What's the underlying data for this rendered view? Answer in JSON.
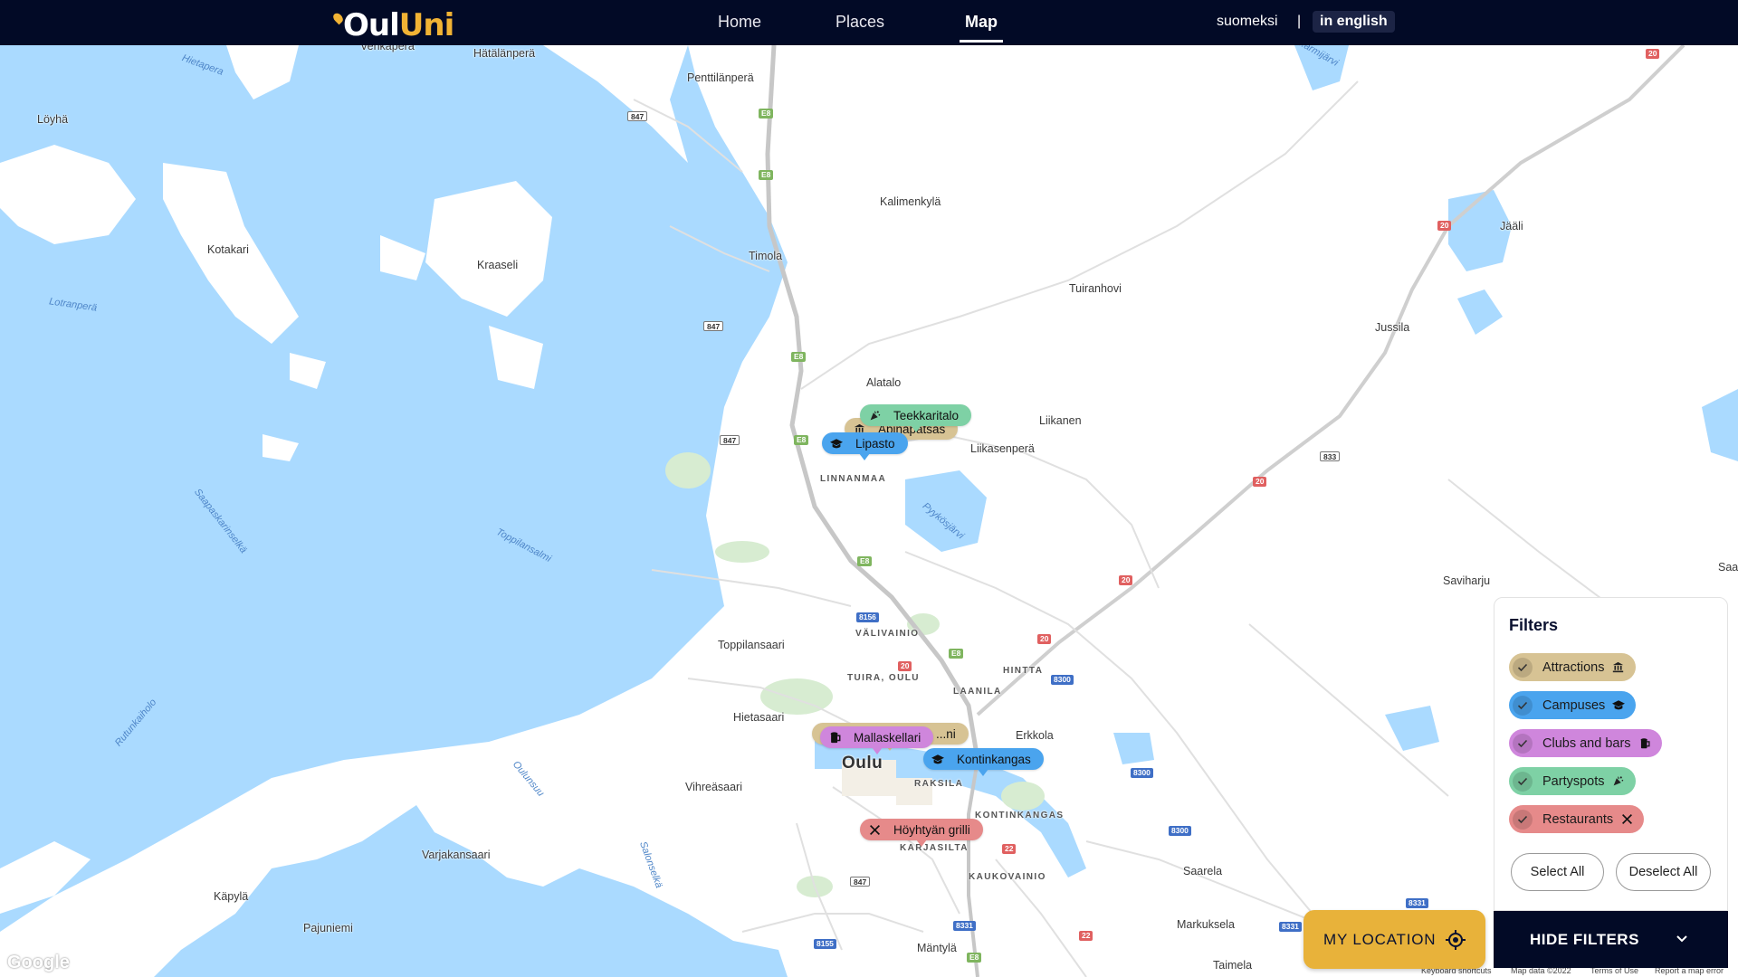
{
  "nav": {
    "logo_oul": "Oul",
    "logo_uni": "Uni",
    "links": [
      "Home",
      "Places",
      "Map"
    ],
    "active": "Map",
    "lang_fi": "suomeksi",
    "lang_sep": "|",
    "lang_en": "in english"
  },
  "map": {
    "places": [
      "Vehkaperä",
      "Hätälänperä",
      "Penttilänperä",
      "Löyhä",
      "Kalimenkylä",
      "Kotakari",
      "Kraaseli",
      "Timola",
      "Tuiranhovi",
      "Jussila",
      "Jääli",
      "Alatalo",
      "Liikanen",
      "Liikasenperä",
      "LINNANMAA",
      "Saviharju",
      "Toppilansaari",
      "VÄLIVAINIO",
      "TUIRA, OULU",
      "HINTTA",
      "LAANILA",
      "Hietasaari",
      "Oulu",
      "Erkkola",
      "Vihreäsaari",
      "RAKSILA",
      "KONTINKANGAS",
      "KARJASILTA",
      "Varjakansaari",
      "KAUKOVAINIO",
      "Saarela",
      "Käpylä",
      "Pajuniemi",
      "Markuksela",
      "Mäntylä",
      "Taimela",
      "Saa"
    ],
    "water_labels": [
      "Hietapera",
      "Lotranperä",
      "Saapaskarinselkä",
      "Toppilansalmi",
      "Pyykösjärvi",
      "Rutunkaiholo",
      "Oulunsuu",
      "Salonselkä",
      "...armijärvi"
    ],
    "shields": [
      "847",
      "E8",
      "20",
      "8156",
      "8300",
      "8155",
      "833",
      "8331",
      "22"
    ],
    "google": "Google",
    "attrib_keyboard": "Keyboard shortcuts",
    "attrib_data": "Map data ©2022",
    "attrib_terms": "Terms of Use",
    "attrib_report": "Report a map error"
  },
  "markers": {
    "teekkaritalo": "Teekkaritalo",
    "apinapatsas": "Apinapatsas",
    "lipasto": "Lipasto",
    "mallaskellari": "Mallaskellari",
    "hidden_attraction": "...ni",
    "kontinkangas": "Kontinkangas",
    "hoyhtyan_grilli": "Höyhtyän grilli"
  },
  "filters": {
    "title": "Filters",
    "items": [
      {
        "label": "Attractions",
        "color": "#d7c394",
        "icon": "museum-icon",
        "checked": true
      },
      {
        "label": "Campuses",
        "color": "#4aa4ee",
        "icon": "graduation-cap-icon",
        "checked": true
      },
      {
        "label": "Clubs and bars",
        "color": "#cf86dc",
        "icon": "beer-mug-icon",
        "checked": true
      },
      {
        "label": "Partyspots",
        "color": "#7ed1a5",
        "icon": "party-popper-icon",
        "checked": true
      },
      {
        "label": "Restaurants",
        "color": "#e68a8a",
        "icon": "fork-knife-icon",
        "checked": true
      }
    ],
    "select_all": "Select All",
    "deselect_all": "Deselect All",
    "hide_filters": "HIDE FILTERS"
  },
  "my_location": "MY LOCATION",
  "colors": {
    "navbar": "#020a26",
    "accent": "#f1b334",
    "water": "#aadaff",
    "land": "#ffffff"
  }
}
